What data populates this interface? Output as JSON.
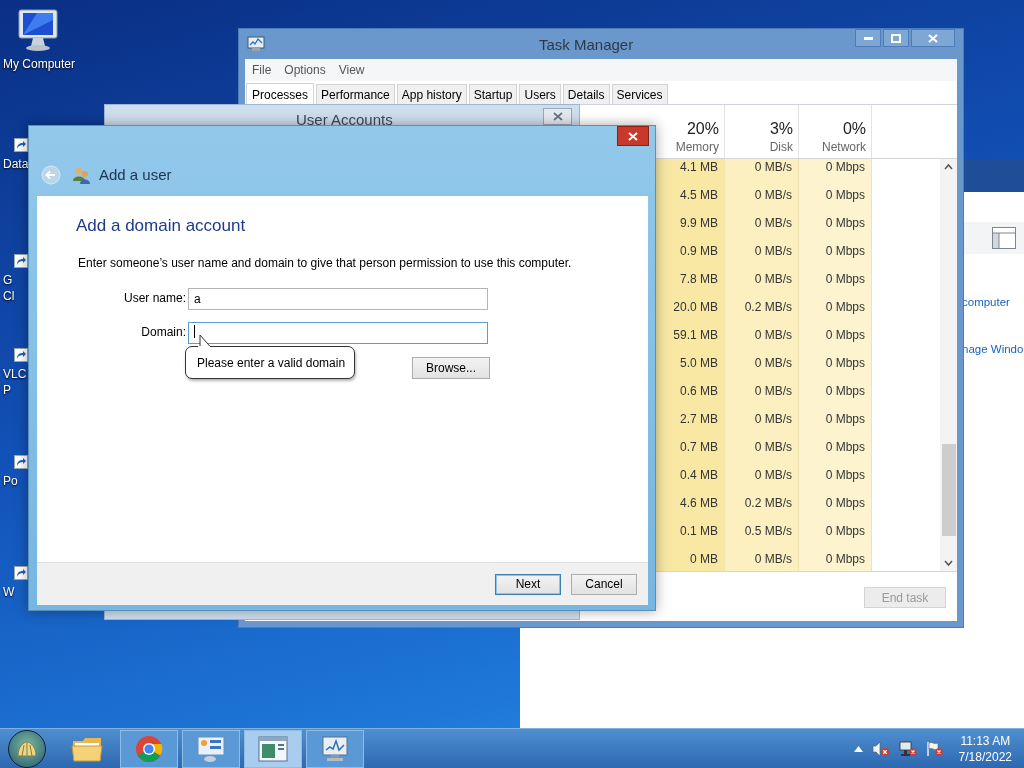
{
  "desktop_icons": [
    {
      "kind": "computer",
      "lines": [
        "My Computer"
      ]
    },
    {
      "kind": "shortcut",
      "lines": [
        "Data"
      ]
    },
    {
      "kind": "shortcut",
      "lines": [
        "G",
        "Cl"
      ]
    },
    {
      "kind": "shortcut",
      "lines": [
        "VLC",
        "P"
      ]
    },
    {
      "kind": "shortcut",
      "lines": [
        "Po"
      ]
    },
    {
      "kind": "shortcut",
      "lines": [
        "W"
      ]
    }
  ],
  "background_window": {
    "links": [
      "computer",
      "nage Windo"
    ]
  },
  "task_manager": {
    "title": "Task Manager",
    "menu": [
      "File",
      "Options",
      "View"
    ],
    "tabs": [
      {
        "label": "Processes",
        "selected": true
      },
      {
        "label": "Performance",
        "selected": false
      },
      {
        "label": "App history",
        "selected": false
      },
      {
        "label": "Startup",
        "selected": false
      },
      {
        "label": "Users",
        "selected": false
      },
      {
        "label": "Details",
        "selected": false
      },
      {
        "label": "Services",
        "selected": false
      }
    ],
    "columns": [
      {
        "percent": "20%",
        "label": "Memory"
      },
      {
        "percent": "3%",
        "label": "Disk"
      },
      {
        "percent": "0%",
        "label": "Network"
      }
    ],
    "rows": [
      [
        "4.1 MB",
        "0 MB/s",
        "0 Mbps"
      ],
      [
        "4.5 MB",
        "0 MB/s",
        "0 Mbps"
      ],
      [
        "9.9 MB",
        "0 MB/s",
        "0 Mbps"
      ],
      [
        "0.9 MB",
        "0 MB/s",
        "0 Mbps"
      ],
      [
        "7.8 MB",
        "0 MB/s",
        "0 Mbps"
      ],
      [
        "20.0 MB",
        "0.2 MB/s",
        "0 Mbps"
      ],
      [
        "59.1 MB",
        "0 MB/s",
        "0 Mbps"
      ],
      [
        "5.0 MB",
        "0 MB/s",
        "0 Mbps"
      ],
      [
        "0.6 MB",
        "0 MB/s",
        "0 Mbps"
      ],
      [
        "2.7 MB",
        "0 MB/s",
        "0 Mbps"
      ],
      [
        "0.7 MB",
        "0 MB/s",
        "0 Mbps"
      ],
      [
        "0.4 MB",
        "0 MB/s",
        "0 Mbps"
      ],
      [
        "4.6 MB",
        "0.2 MB/s",
        "0 Mbps"
      ],
      [
        "0.1 MB",
        "0.5 MB/s",
        "0 Mbps"
      ],
      [
        "0 MB",
        "0 MB/s",
        "0 Mbps"
      ]
    ],
    "end_task": {
      "label": "End task",
      "disabled": true
    }
  },
  "user_accounts": {
    "title": "User Accounts"
  },
  "dialog": {
    "title": "Add a user",
    "heading": "Add a domain account",
    "instruction": "Enter someone’s user name and domain to give that person permission to use this computer.",
    "fields": [
      {
        "label": "User name:",
        "value": "a",
        "focused": false
      },
      {
        "label": "Domain:",
        "focused": true
      }
    ],
    "tooltip": "Please enter a valid domain",
    "browse": "Browse...",
    "buttons": [
      {
        "label": "Next",
        "default": true
      },
      {
        "label": "Cancel",
        "default": false
      }
    ]
  },
  "taskbar": {
    "apps": [
      {
        "kind": "folder",
        "running": false,
        "active": false
      },
      {
        "kind": "browser",
        "running": true,
        "active": false
      },
      {
        "kind": "control-panel",
        "running": true,
        "active": false
      },
      {
        "kind": "document",
        "running": true,
        "active": true
      },
      {
        "kind": "monitor",
        "running": true,
        "active": false
      }
    ],
    "time": "11:13 AM",
    "date": "7/18/2022"
  }
}
